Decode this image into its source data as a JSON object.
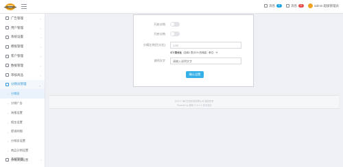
{
  "topbar": {
    "right_items": [
      {
        "icon": "message-icon",
        "label": "消息",
        "badge": "0",
        "badge_color": "#1aa3e0"
      },
      {
        "icon": "bell-icon",
        "label": "消息",
        "badge": "0",
        "badge_color": "#e94b4b"
      }
    ],
    "user_label": "admin 超级管理员"
  },
  "sidebar": {
    "items": [
      {
        "icon": "grid-icon",
        "label": "广告管理"
      },
      {
        "icon": "user-icon",
        "label": "用户管理"
      },
      {
        "icon": "gear-icon",
        "label": "系统设置"
      },
      {
        "icon": "edit-icon",
        "label": "模板管理"
      },
      {
        "icon": "person-icon",
        "label": "客户管理"
      },
      {
        "icon": "chart-icon",
        "label": "数据管理"
      },
      {
        "icon": "doc-icon",
        "label": "审核商品"
      },
      {
        "icon": "share-icon",
        "label": "分销员管理"
      }
    ],
    "sub_items": [
      {
        "label": "分销员"
      },
      {
        "label": "分销广告"
      },
      {
        "label": "海报设置"
      },
      {
        "label": "佣金设置"
      },
      {
        "label": "提现明细"
      },
      {
        "label": "分销员设置"
      },
      {
        "label": "商品分销设置"
      },
      {
        "label": "分销文案设置"
      }
    ],
    "bottom_item": {
      "icon": "settings-icon",
      "label": "系统管理"
    }
  },
  "form": {
    "toggle_1_label": "开启分销",
    "toggle_2_label": "开启分销",
    "input_1_label": "分佣比例(百分比)",
    "input_1_value": "1.00",
    "hint_prefix": "填写",
    "hint_bold": "百分比",
    "hint_suffix": "（如填1 表示1% 的佣金）单位：%",
    "input_2_label": "说明文字",
    "input_2_placeholder": "请输入说明文字",
    "submit_label": "确认设置"
  },
  "footer": {
    "line1": "2019 © 海口在线科技有限公司 版权所有",
    "line2": "Powered by 基础 © v1.0.1 技术支持"
  }
}
